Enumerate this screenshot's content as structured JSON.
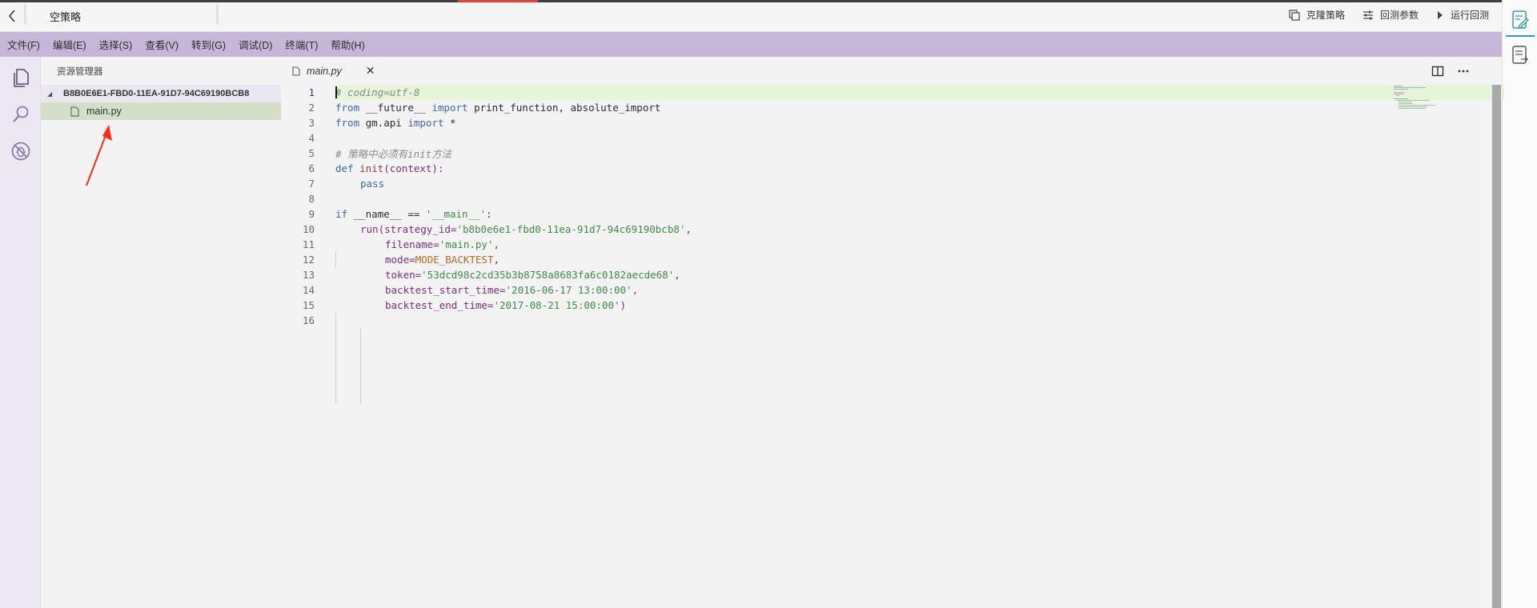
{
  "titlebar": {
    "title": "空策略",
    "actions": [
      {
        "label": "克隆策略",
        "icon": "clone-icon"
      },
      {
        "label": "回测参数",
        "icon": "sliders-icon"
      },
      {
        "label": "运行回测",
        "icon": "play-icon"
      }
    ]
  },
  "menu": [
    "文件(F)",
    "编辑(E)",
    "选择(S)",
    "查看(V)",
    "转到(G)",
    "调试(D)",
    "终端(T)",
    "帮助(H)"
  ],
  "activity_bar": [
    "files-icon",
    "search-icon",
    "debug-icon"
  ],
  "explorer": {
    "title": "资源管理器",
    "folder": "B8B0E6E1-FBD0-11EA-91D7-94C69190BCB8",
    "file": "main.py"
  },
  "editor": {
    "tab_label": "main.py",
    "tab_close": "✕",
    "line_numbers": [
      "1",
      "2",
      "3",
      "4",
      "5",
      "6",
      "7",
      "8",
      "9",
      "10",
      "11",
      "12",
      "13",
      "14",
      "15",
      "16"
    ],
    "tokens": {
      "l1_comment": "# coding=utf-8",
      "l2_from": "from",
      "l2_module": " __future__ ",
      "l2_import": "import",
      "l2_names": " print_function, absolute_import",
      "l3_from": "from",
      "l3_module": " gm.api ",
      "l3_import": "import",
      "l3_star": " *",
      "l5_comment": "# 策略中必须有init方法",
      "l6_def": "def",
      "l6_fn": " init",
      "l6_args": "(context):",
      "l7_pass": "pass",
      "l9_if": "if",
      "l9_name": " __name__ == ",
      "l9_str": "'__main__'",
      "l9_colon": ":",
      "l10_call": "run(strategy_id=",
      "l10_str": "'b8b0e6e1-fbd0-11ea-91d7-94c69190bcb8'",
      "l10_comma": ",",
      "l11_key": "filename=",
      "l11_str": "'main.py'",
      "l11_comma": ",",
      "l12_key": "mode=",
      "l12_const": "MODE_BACKTEST",
      "l12_comma": ",",
      "l13_key": "token=",
      "l13_str": "'53dcd98c2cd35b3b8758a8683fa6c0182aecde68'",
      "l13_comma": ",",
      "l14_key": "backtest_start_time=",
      "l14_str": "'2016-06-17 13:00:00'",
      "l14_comma": ",",
      "l15_key": "backtest_end_time=",
      "l15_str": "'2017-08-21 15:00:00'",
      "l15_close": ")"
    }
  },
  "colors": {
    "menubar": "#c6b7d8",
    "current_line": "#e6f4d7",
    "selected_file": "#d5dec9",
    "accent_red": "#e8413b",
    "accent_teal": "#2aa39a",
    "annotation_arrow": "#ff2a1a"
  }
}
